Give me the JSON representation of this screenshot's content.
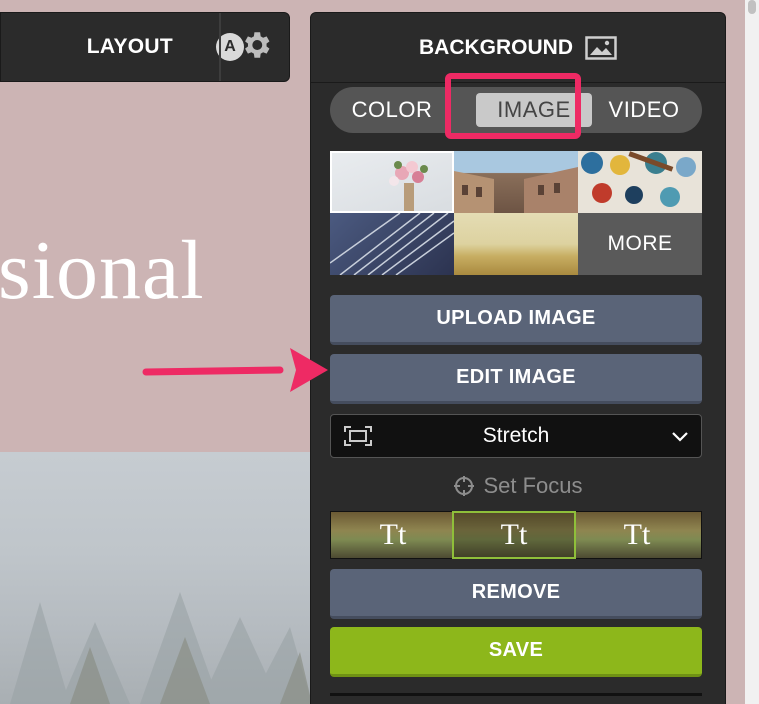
{
  "toolbar": {
    "layout_label": "LAYOUT",
    "layout_badge": "A"
  },
  "canvas": {
    "hero_text": "sional"
  },
  "panel": {
    "title": "BACKGROUND",
    "tabs": [
      {
        "label": "COLOR",
        "selected": false
      },
      {
        "label": "IMAGE",
        "selected": true
      },
      {
        "label": "VIDEO",
        "selected": false
      }
    ],
    "more_label": "MORE",
    "upload_label": "UPLOAD IMAGE",
    "edit_label": "EDIT IMAGE",
    "fit_mode": "Stretch",
    "focus_label": "Set Focus",
    "text_style_sample": "Tt",
    "remove_label": "REMOVE",
    "save_label": "SAVE"
  },
  "colors": {
    "panel_bg": "#2b2b2b",
    "button_bg": "#5a6478",
    "save_bg": "#8db71b",
    "highlight": "#ee2a64",
    "canvas_bg": "#ccb4b4"
  },
  "icons": [
    "gear-icon",
    "image-icon",
    "fit-icon",
    "chevron-down-icon",
    "crosshair-icon",
    "arrow-annotation"
  ]
}
